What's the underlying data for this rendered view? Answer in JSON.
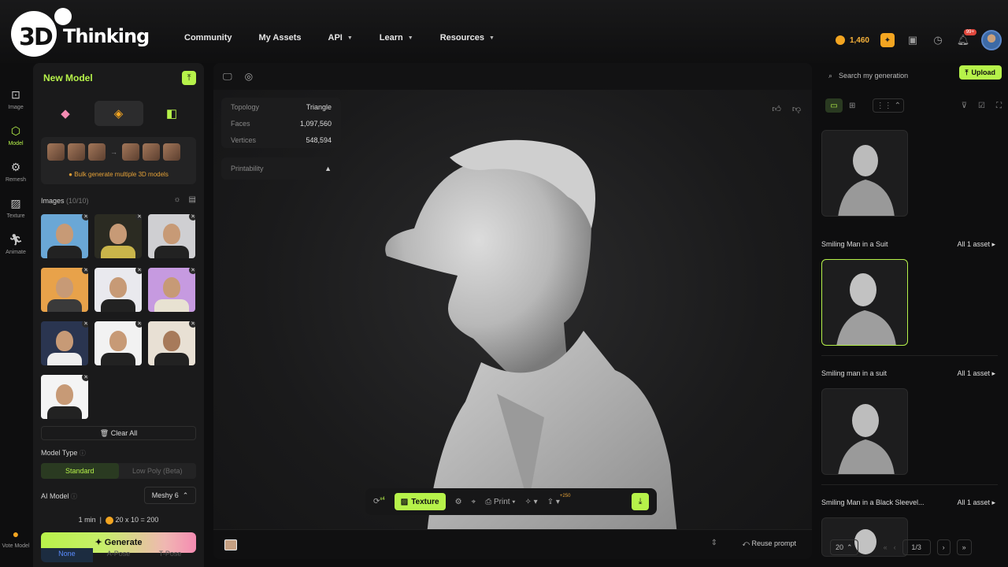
{
  "brand": {
    "name": "Thinking",
    "prefix": "3D"
  },
  "nav": [
    {
      "label": "Community"
    },
    {
      "label": "My Assets"
    },
    {
      "label": "API"
    },
    {
      "label": "Learn"
    },
    {
      "label": "Resources"
    }
  ],
  "top_right": {
    "credits": "1,460",
    "notif_badge": "99+"
  },
  "rail": [
    {
      "label": "Image",
      "icon": "image-icon"
    },
    {
      "label": "Model",
      "icon": "cube-icon"
    },
    {
      "label": "Remesh",
      "icon": "remesh-icon"
    },
    {
      "label": "Texture",
      "icon": "texture-icon"
    },
    {
      "label": "Animate",
      "icon": "run-icon"
    },
    {
      "label": "Vote Model",
      "icon": "vote-icon"
    }
  ],
  "panel": {
    "title": "New Model",
    "bulk_label": "Bulk generate multiple 3D models",
    "images_label": "Images",
    "images_count": "(10/10)",
    "clear_all": "Clear All",
    "model_type_label": "Model Type",
    "model_types": [
      "Standard",
      "Low Poly (Beta)"
    ],
    "ai_model_label": "AI Model",
    "ai_model_value": "Meshy 6",
    "time": "1 min",
    "cost": "20 x 10 = 200",
    "generate": "Generate",
    "poses": [
      "None",
      "A-Pose",
      "T-Pose"
    ]
  },
  "viewer": {
    "stats": [
      {
        "k": "Topology",
        "v": "Triangle"
      },
      {
        "k": "Faces",
        "v": "1,097,560"
      },
      {
        "k": "Vertices",
        "v": "548,594"
      }
    ],
    "printability": "Printability",
    "toolbar": {
      "rotate_sup": "x4",
      "texture": "Texture",
      "print": "Print",
      "share_sup": "+250"
    },
    "reuse_prompt": "Reuse prompt"
  },
  "right": {
    "search_placeholder": "Search my generation",
    "upload": "Upload",
    "groups": [
      {
        "title": "Smiling Man in a Suit",
        "all": "All 1 asset"
      },
      {
        "title": "Smiling man in a suit",
        "all": "All 1 asset"
      },
      {
        "title": "Smiling Man in a Black Sleevel...",
        "all": "All 1 asset"
      }
    ],
    "pager": {
      "size": "20",
      "page": "1/3"
    }
  },
  "colors": {
    "accent": "#b6f24a",
    "gold": "#f3a521",
    "bg": "#0e0e0f",
    "panel": "#1a1a1b"
  }
}
